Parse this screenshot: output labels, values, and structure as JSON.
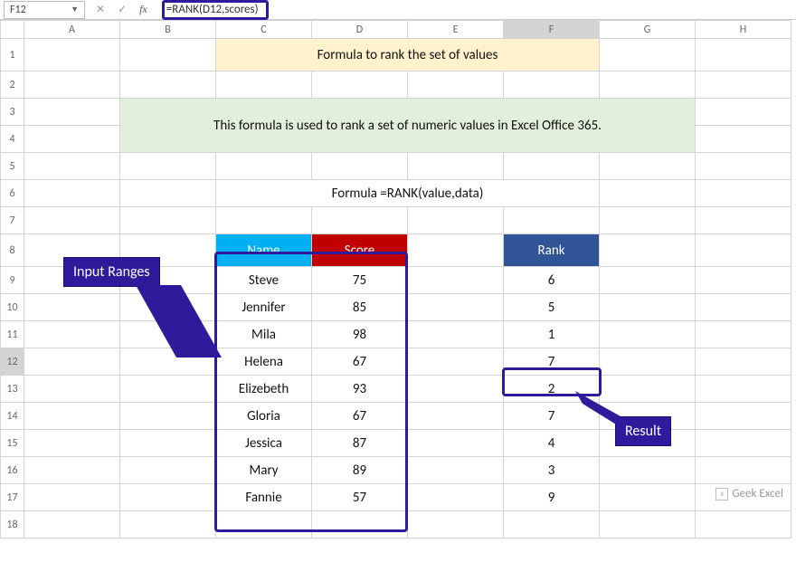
{
  "namebox": {
    "value": "F12"
  },
  "formula_bar": {
    "value": "=RANK(D12,scores)"
  },
  "columns": [
    "A",
    "B",
    "C",
    "D",
    "E",
    "F",
    "G",
    "H"
  ],
  "rows": [
    1,
    2,
    3,
    4,
    5,
    6,
    7,
    8,
    9,
    10,
    11,
    12,
    13,
    14,
    15,
    16,
    17,
    18
  ],
  "title1": "Formula to rank the set of values",
  "title2": "This formula is used to rank a set of numeric values in Excel Office 365.",
  "formula_text": "Formula =RANK(value,data)",
  "headers": {
    "name": "Name",
    "score": "Score",
    "rank": "Rank"
  },
  "data": [
    {
      "name": "Steve",
      "score": 75,
      "rank": 6
    },
    {
      "name": "Jennifer",
      "score": 85,
      "rank": 5
    },
    {
      "name": "Mila",
      "score": 98,
      "rank": 1
    },
    {
      "name": "Helena",
      "score": 67,
      "rank": 7
    },
    {
      "name": "Elizebeth",
      "score": 93,
      "rank": 2
    },
    {
      "name": "Gloria",
      "score": 67,
      "rank": 7
    },
    {
      "name": "Jessica",
      "score": 87,
      "rank": 4
    },
    {
      "name": "Mary",
      "score": 89,
      "rank": 3
    },
    {
      "name": "Fannie",
      "score": 57,
      "rank": 9
    }
  ],
  "callouts": {
    "input": "Input Ranges",
    "result": "Result"
  },
  "watermark": "Geek Excel",
  "selected_cell": "F12",
  "chart_data": {
    "type": "table",
    "title": "Formula to rank the set of values",
    "columns": [
      "Name",
      "Score",
      "Rank"
    ],
    "rows": [
      [
        "Steve",
        75,
        6
      ],
      [
        "Jennifer",
        85,
        5
      ],
      [
        "Mila",
        98,
        1
      ],
      [
        "Helena",
        67,
        7
      ],
      [
        "Elizebeth",
        93,
        2
      ],
      [
        "Gloria",
        67,
        7
      ],
      [
        "Jessica",
        87,
        4
      ],
      [
        "Mary",
        89,
        3
      ],
      [
        "Fannie",
        57,
        9
      ]
    ]
  }
}
